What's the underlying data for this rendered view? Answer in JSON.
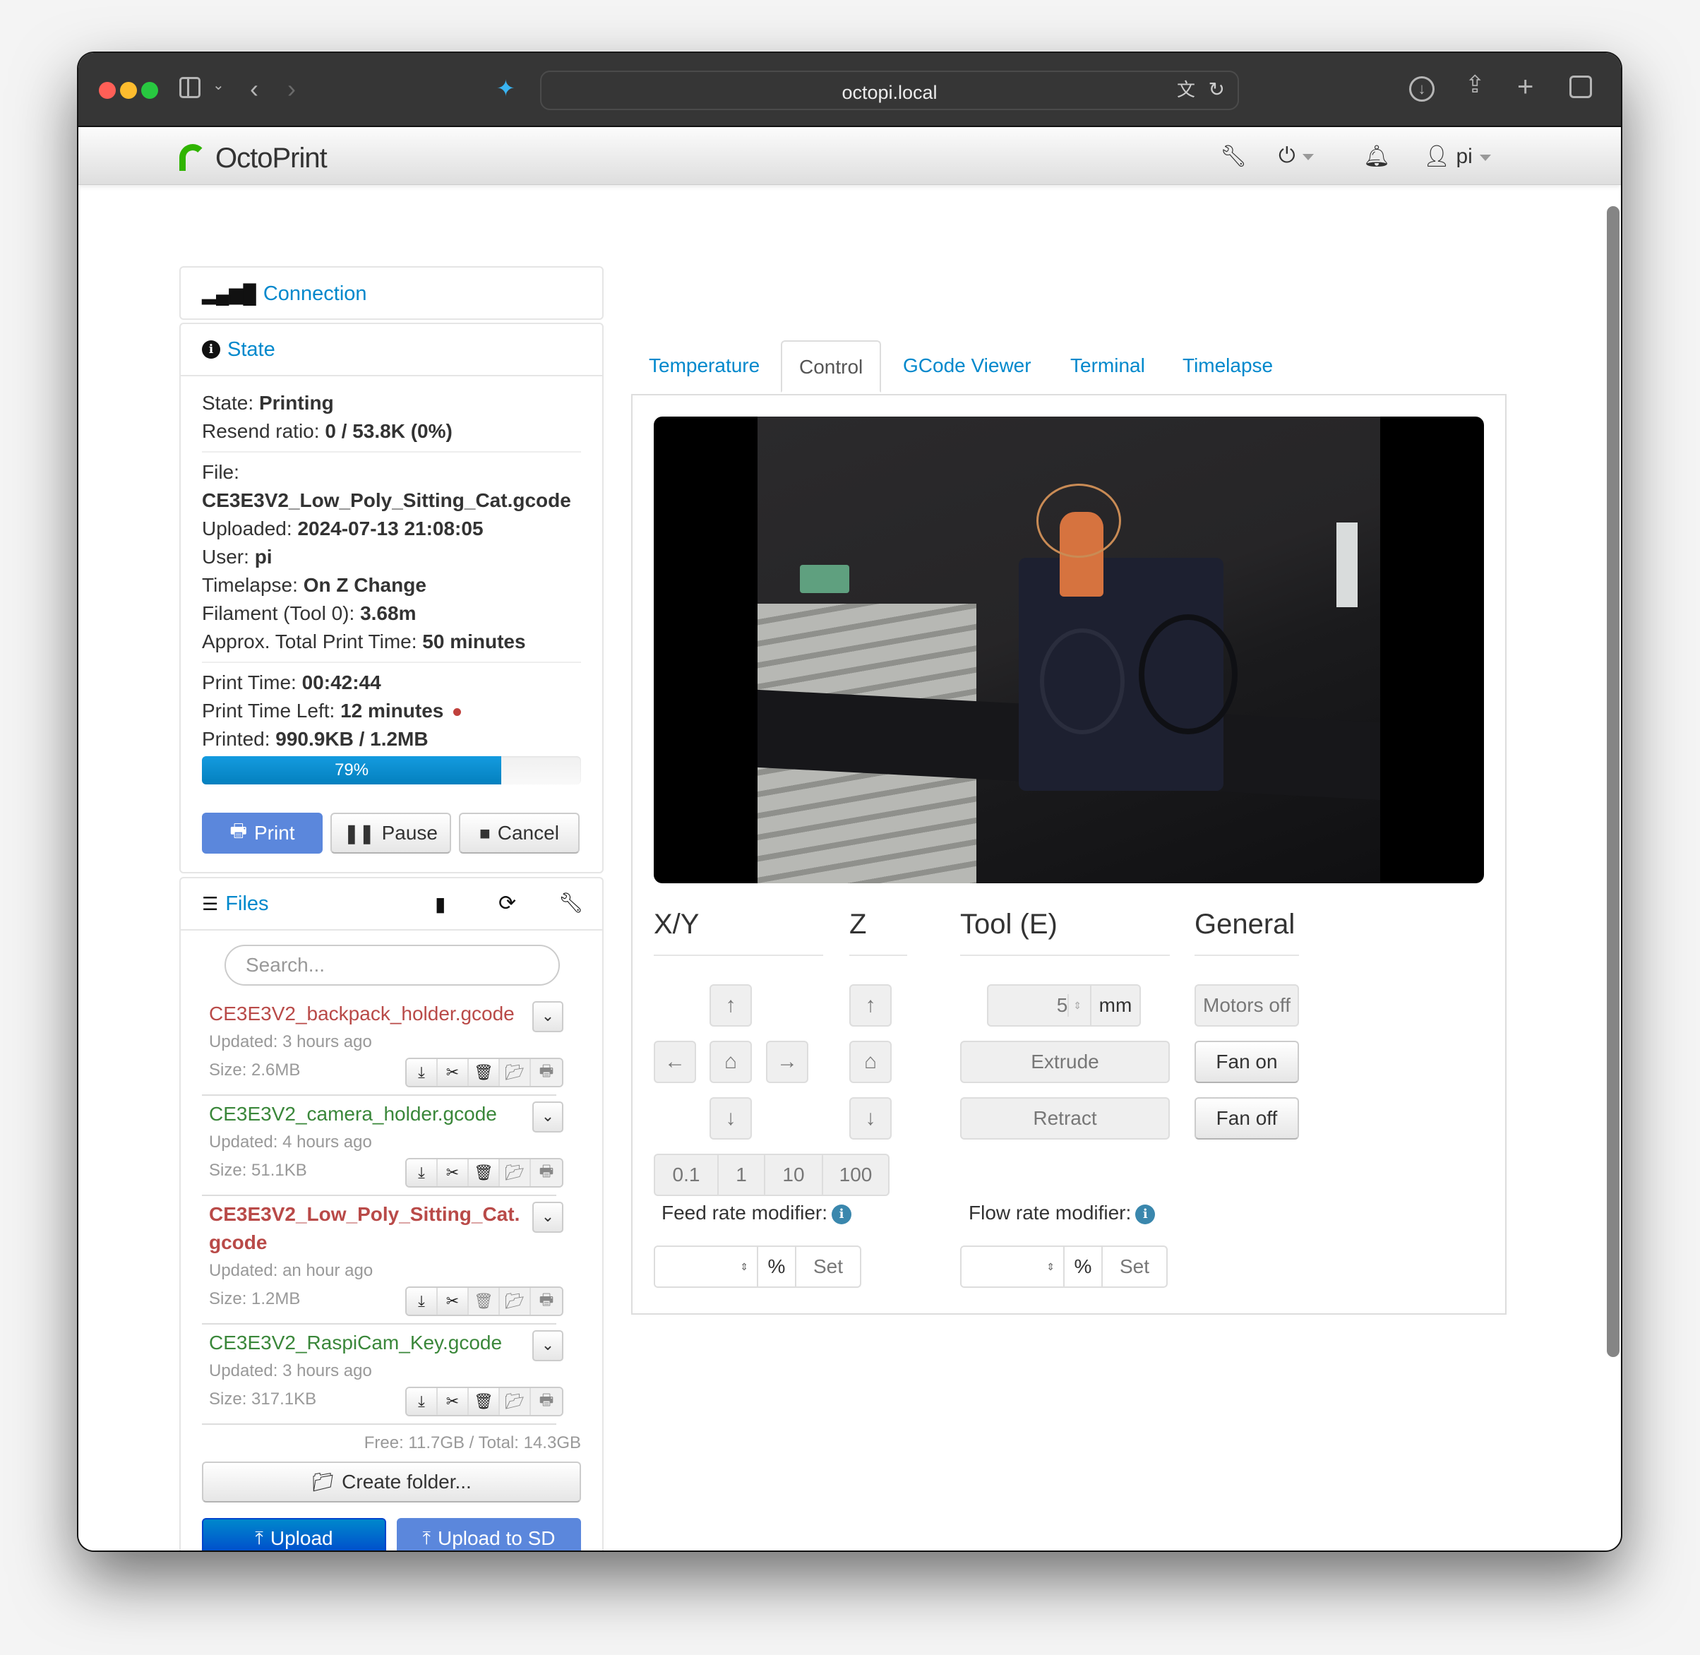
{
  "browser": {
    "url": "octopi.local",
    "traffic_lights": {
      "close": "#ff5f57",
      "minimize": "#febc2e",
      "maximize": "#28c840"
    }
  },
  "navbar": {
    "brand": "OctoPrint",
    "user": "pi"
  },
  "sidebar": {
    "connection": {
      "title": "Connection"
    },
    "state": {
      "title": "State",
      "state_label": "State: ",
      "state_value": "Printing",
      "resend_label": "Resend ratio: ",
      "resend_value": "0 / 53.8K (0%)",
      "file_label": "File:",
      "file_value": "CE3E3V2_Low_Poly_Sitting_Cat.gcode",
      "uploaded_label": "Uploaded: ",
      "uploaded_value": "2024-07-13 21:08:05",
      "user_label": "User: ",
      "user_value": "pi",
      "timelapse_label": "Timelapse: ",
      "timelapse_value": "On Z Change",
      "filament_label": "Filament (Tool 0): ",
      "filament_value": "3.68m",
      "approx_label": "Approx. Total Print Time: ",
      "approx_value": "50 minutes",
      "print_time_label": "Print Time: ",
      "print_time_value": "00:42:44",
      "time_left_label": "Print Time Left: ",
      "time_left_value": "12 minutes",
      "printed_label": "Printed: ",
      "printed_value": "990.9KB / 1.2MB",
      "progress_percent": 79,
      "progress_text": "79%",
      "buttons": {
        "print": "Print",
        "pause": "Pause",
        "cancel": "Cancel"
      }
    },
    "files": {
      "title": "Files",
      "search_placeholder": "Search...",
      "items": [
        {
          "name": "CE3E3V2_backpack_holder.gcode",
          "updated": "Updated: 3 hours ago",
          "size": "Size: 2.6MB",
          "status": "failed"
        },
        {
          "name": "CE3E3V2_camera_holder.gcode",
          "updated": "Updated: 4 hours ago",
          "size": "Size: 51.1KB",
          "status": "success"
        },
        {
          "name": "CE3E3V2_Low_Poly_Sitting_Cat.gcode",
          "name_line1": "CE3E3V2_Low_Poly_Sitting_Cat.",
          "name_line2": "gcode",
          "updated": "Updated: an hour ago",
          "size": "Size: 1.2MB",
          "status": "printing"
        },
        {
          "name": "CE3E3V2_RaspiCam_Key.gcode",
          "updated": "Updated: 3 hours ago",
          "size": "Size: 317.1KB",
          "status": "success"
        }
      ],
      "storage": "Free: 11.7GB / Total: 14.3GB",
      "create_folder": "Create folder...",
      "upload": "Upload",
      "upload_sd": "Upload to SD"
    }
  },
  "tabs": [
    "Temperature",
    "Control",
    "GCode Viewer",
    "Terminal",
    "Timelapse"
  ],
  "active_tab": "Control",
  "control": {
    "xy_title": "X/Y",
    "z_title": "Z",
    "tool_title": "Tool (E)",
    "general_title": "General",
    "step_sizes": [
      "0.1",
      "1",
      "10",
      "100"
    ],
    "extrude_amount": "5",
    "extrude_unit": "mm",
    "extrude": "Extrude",
    "retract": "Retract",
    "motors_off": "Motors off",
    "fan_on": "Fan on",
    "fan_off": "Fan off",
    "feed_rate_label": "Feed rate modifier:",
    "flow_rate_label": "Flow rate modifier:",
    "percent": "%",
    "set": "Set",
    "feed_rate_value": "",
    "flow_rate_value": ""
  }
}
